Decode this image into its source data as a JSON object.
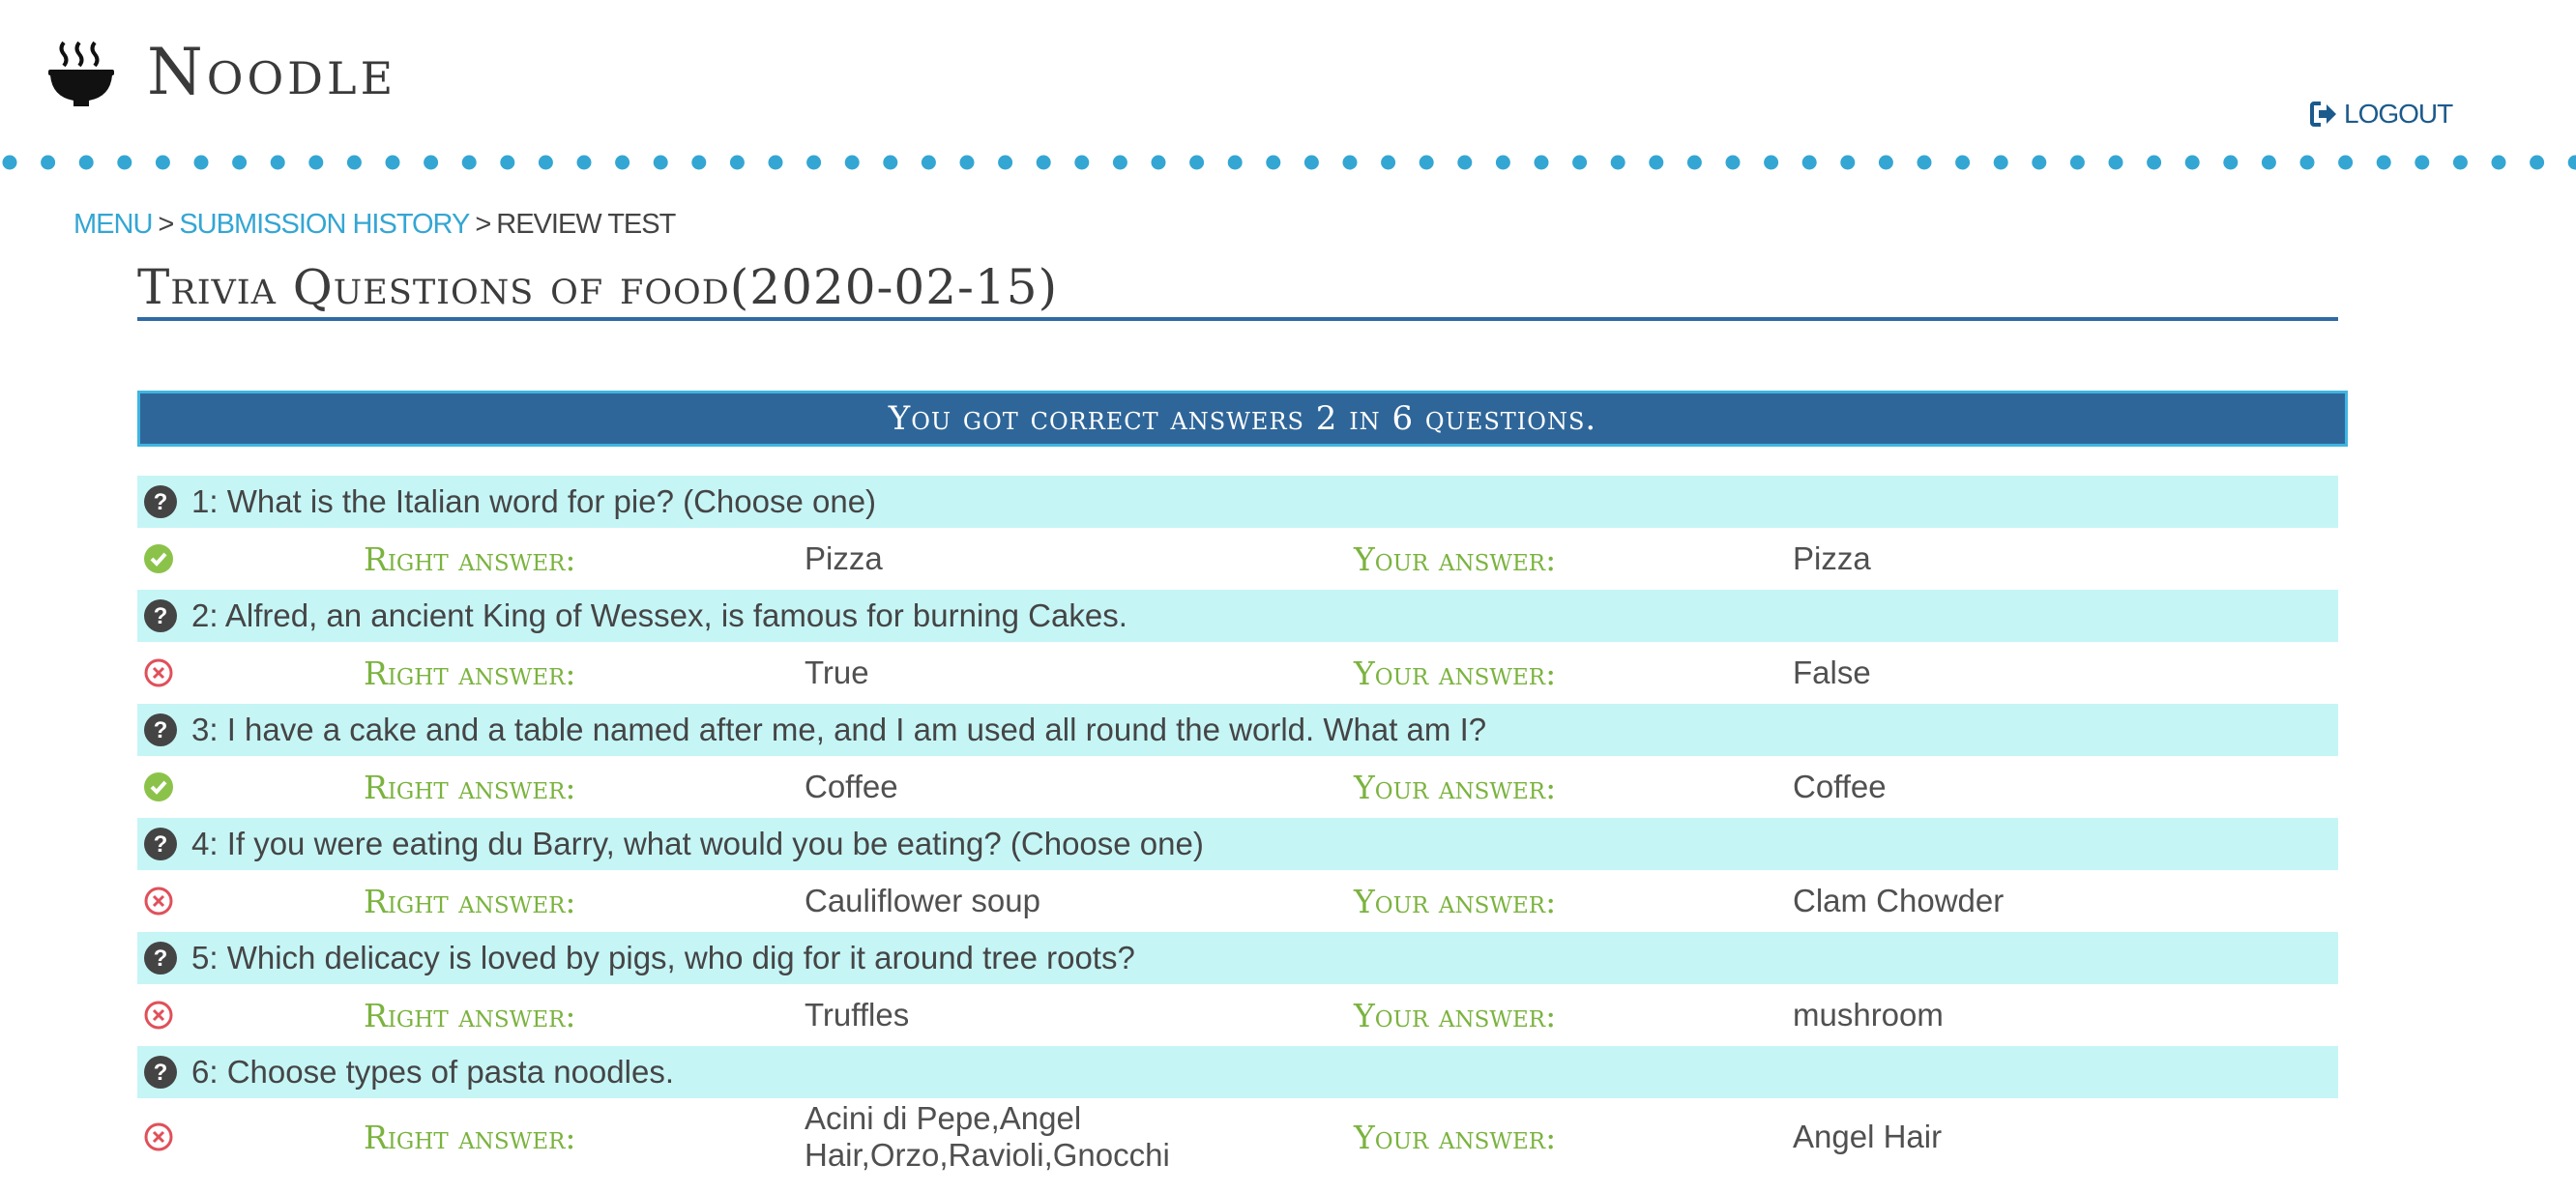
{
  "app": {
    "brand": "Noodle",
    "logout_label": "LOGOUT"
  },
  "breadcrumb": {
    "menu": "MENU",
    "history": "SUBMISSION HISTORY",
    "current": "REVIEW TEST",
    "separator": ">"
  },
  "test": {
    "title": "Trivia Questions of food(2020-02-15)",
    "summary": "You got correct answers 2 in 6 questions.",
    "right_label": "Right answer:",
    "your_label": "Your answer:"
  },
  "questions": [
    {
      "text": "1: What is the Italian word for pie? (Choose one)",
      "right": "Pizza",
      "yours": "Pizza",
      "status": "correct"
    },
    {
      "text": "2: Alfred, an ancient King of Wessex, is famous for burning Cakes.",
      "right": "True",
      "yours": "False",
      "status": "wrong"
    },
    {
      "text": "3: I have a cake and a table named after me, and I am used all round the world. What am I?",
      "right": "Coffee",
      "yours": "Coffee",
      "status": "correct"
    },
    {
      "text": "4: If you were eating du Barry, what would you be eating? (Choose one)",
      "right": "Cauliflower soup",
      "yours": "Clam Chowder",
      "status": "wrong"
    },
    {
      "text": "5: Which delicacy is loved by pigs, who dig for it around tree roots?",
      "right": "Truffles",
      "yours": "mushroom",
      "status": "wrong"
    },
    {
      "text": "6: Choose types of pasta noodles.",
      "right": "Acini di Pepe,Angel Hair,Orzo,Ravioli,Gnocchi",
      "yours": "Angel Hair",
      "status": "wrong"
    }
  ],
  "colors": {
    "accent": "#34a6d3",
    "banner": "#2f6699",
    "question_bg": "#c6f5f6",
    "label": "#7bb33f",
    "correct": "#8bc34a",
    "wrong": "#e0505a"
  },
  "icons": {
    "logo": "noodle-bowl-icon",
    "logout": "logout-icon",
    "question": "question-circle-icon",
    "correct": "check-circle-icon",
    "wrong": "x-circle-icon"
  }
}
